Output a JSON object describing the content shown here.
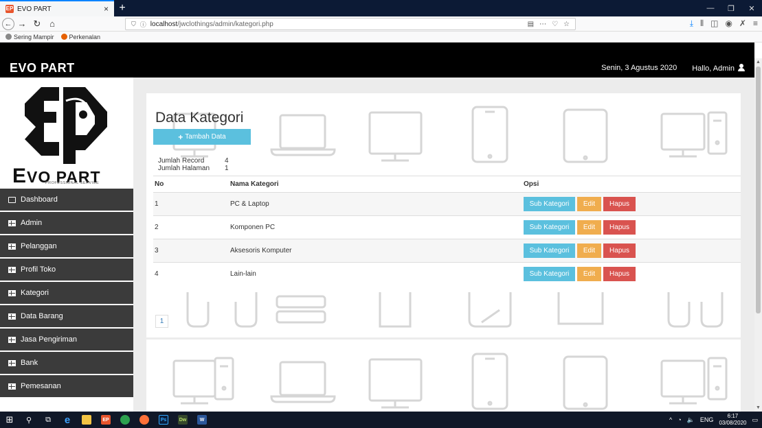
{
  "browser": {
    "tab_title": "EVO PART",
    "tab_close": "×",
    "new_tab": "+",
    "url_host": "localhost",
    "url_path": "/jwclothings/admin/kategori.php",
    "bookmarks": [
      "Sering Mampir",
      "Perkenalan"
    ]
  },
  "header": {
    "brand": "EVO PART",
    "date": "Senin, 3 Agustus 2020",
    "greeting": "Hallo, Admin"
  },
  "logo": {
    "text_first": "E",
    "text_rest": "VO PART",
    "subtitle": "PROFESSIONAL SERVICE"
  },
  "sidebar": {
    "items": [
      {
        "label": "Dashboard",
        "icon": "monitor-icon"
      },
      {
        "label": "Admin",
        "icon": "table-icon"
      },
      {
        "label": "Pelanggan",
        "icon": "table-icon"
      },
      {
        "label": "Profil Toko",
        "icon": "table-icon"
      },
      {
        "label": "Kategori",
        "icon": "table-icon"
      },
      {
        "label": "Data Barang",
        "icon": "table-icon"
      },
      {
        "label": "Jasa Pengiriman",
        "icon": "table-icon"
      },
      {
        "label": "Bank",
        "icon": "table-icon"
      },
      {
        "label": "Pemesanan",
        "icon": "table-icon"
      }
    ]
  },
  "main": {
    "title": "Data Kategori",
    "add_button": "Tambah Data",
    "stats": {
      "record_label": "Jumlah Record",
      "record_value": "4",
      "page_label": "Jumlah Halaman",
      "page_value": "1"
    },
    "table": {
      "headers": [
        "No",
        "Nama Kategori",
        "Opsi"
      ],
      "rows": [
        {
          "no": "1",
          "name": "PC & Laptop"
        },
        {
          "no": "2",
          "name": "Komponen PC"
        },
        {
          "no": "3",
          "name": "Aksesoris Komputer"
        },
        {
          "no": "4",
          "name": "Lain-lain"
        }
      ],
      "action_labels": {
        "sub": "Sub Kategori",
        "edit": "Edit",
        "delete": "Hapus"
      }
    },
    "pagination": [
      "1"
    ]
  },
  "taskbar": {
    "lang": "ENG",
    "time": "6:17",
    "date": "03/08/2020"
  },
  "colors": {
    "info": "#5bc0de",
    "warning": "#f0ad4e",
    "danger": "#d9534f",
    "sidebar": "#3b3b3b"
  }
}
